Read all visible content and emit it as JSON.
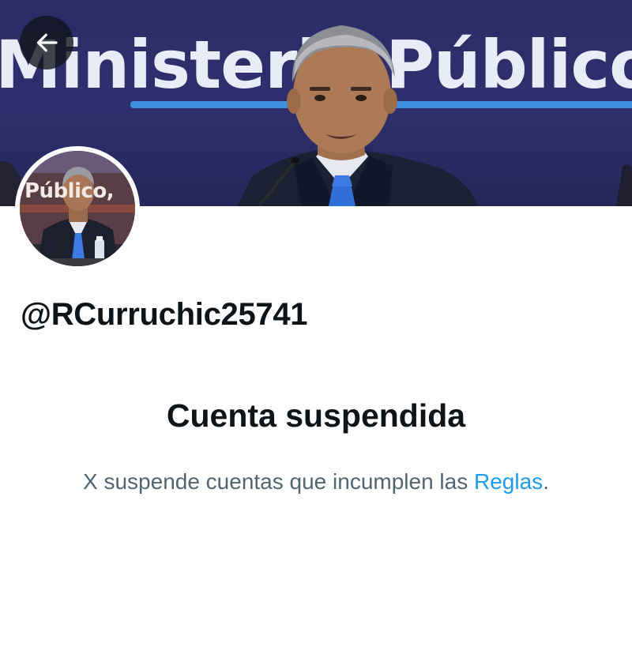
{
  "banner": {
    "headline_text": "Ministerio Público,",
    "image_icon": "banner-photo"
  },
  "back_button": {
    "icon": "arrow-left-icon"
  },
  "avatar": {
    "headline_text": "Público,",
    "image_icon": "avatar-photo"
  },
  "profile": {
    "handle": "@RCurruchic25741"
  },
  "suspension": {
    "title": "Cuenta suspendida",
    "body_prefix": "X suspende cuentas que incumplen las ",
    "rules_link": "Reglas",
    "body_suffix": "."
  },
  "colors": {
    "link": "#1d9bf0",
    "secondary_text": "#536471",
    "primary_text": "#0f1419",
    "banner_bg": "#2b2b66",
    "banner_stripe": "#3f8fe0"
  }
}
